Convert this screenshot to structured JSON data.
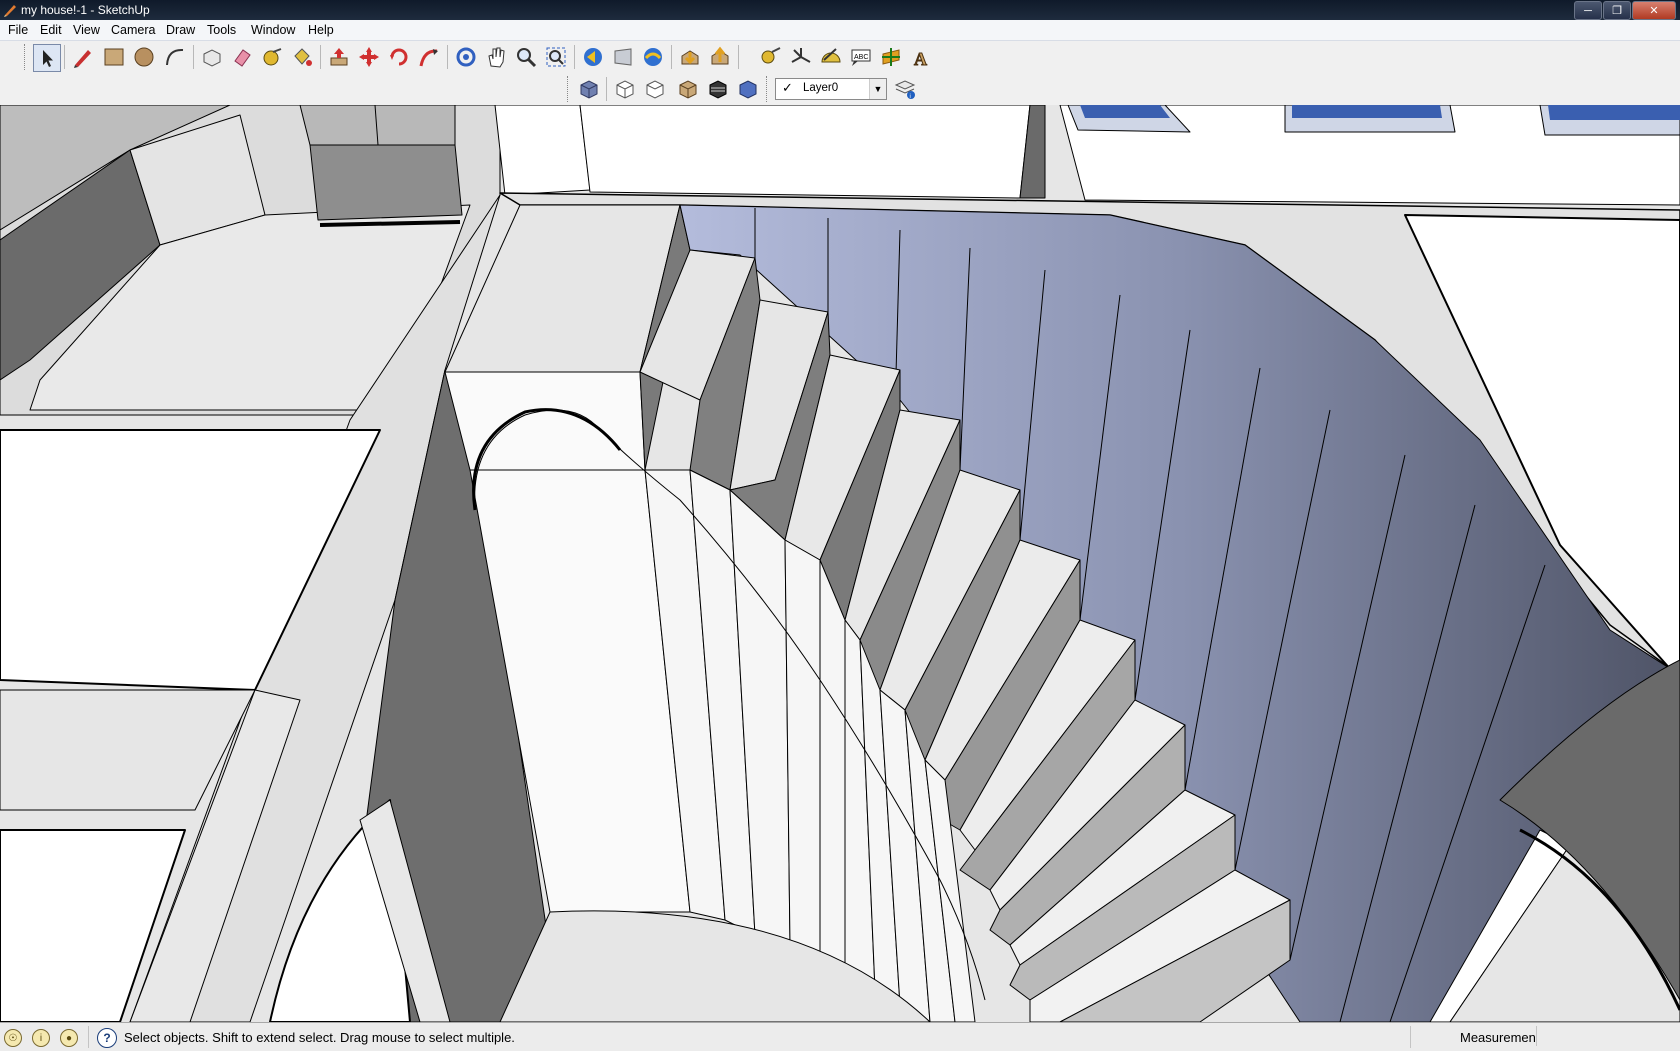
{
  "window": {
    "title": "my house!-1 - SketchUp"
  },
  "menu": [
    "File",
    "Edit",
    "View",
    "Camera",
    "Draw",
    "Tools",
    "Window",
    "Help"
  ],
  "toolbar": {
    "row1": [
      "select-tool",
      "line-tool",
      "rectangle-tool",
      "circle-tool",
      "arc-tool",
      "make-component",
      "eraser-tool",
      "tape-measure-tool",
      "paint-bucket-tool",
      "push-pull-tool",
      "move-tool",
      "rotate-tool",
      "follow-me-tool",
      "orbit-tool",
      "pan-tool",
      "zoom-tool",
      "zoom-extents-tool",
      "previous-view",
      "next-view",
      "position-camera",
      "get-models",
      "share-model",
      "dimension-tool",
      "axes-tool",
      "protractor-tool",
      "text-tool",
      "3d-text-tool",
      "section-plane-tool"
    ],
    "row2": [
      "iso-view",
      "top-view",
      "front-view",
      "xray-style",
      "shaded-style",
      "shaded-textures-style"
    ]
  },
  "layers": {
    "current": "Layer0",
    "checked": true
  },
  "status": {
    "hint": "Select objects. Shift to extend select. Drag mouse to select multiple.",
    "measurements_label": "Measurements",
    "measurements_value": ""
  }
}
